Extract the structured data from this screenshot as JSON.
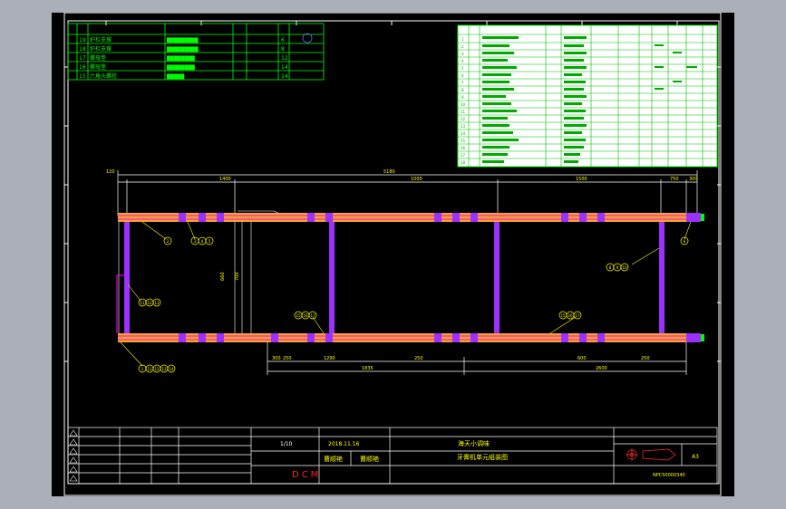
{
  "parts_table": {
    "rows": [
      {
        "no": "19",
        "name": "护栏支撑",
        "code": "█████████",
        "qty": "6"
      },
      {
        "no": "18",
        "name": "护栏支撑",
        "code": "█████████",
        "qty": "8"
      },
      {
        "no": "17",
        "name": "螺母垫",
        "code": "████████",
        "qty": "12"
      },
      {
        "no": "16",
        "name": "螺母垫",
        "code": "████████",
        "qty": "14"
      },
      {
        "no": "15",
        "name": "六角头螺栓",
        "code": "█████",
        "qty": "14"
      }
    ]
  },
  "dimensions": {
    "overall": "5180",
    "segments": [
      "1400",
      "1000",
      "1500",
      "750",
      "700"
    ],
    "end_left": "120",
    "end_right": "300",
    "bottom_left": "1835",
    "bottom_right": "2600",
    "bottom_segments": [
      "300",
      "250",
      "1290",
      "250",
      "600",
      "250",
      "750"
    ],
    "height_a": "660",
    "height_b": "700"
  },
  "balloons": {
    "left_top": "2",
    "group_top": [
      "3",
      "4",
      "5"
    ],
    "right_top": "6",
    "right_mid": [
      "8",
      "9",
      "10"
    ],
    "left_mid": [
      "11",
      "12",
      "13"
    ],
    "bottom_left": [
      "1",
      "11",
      "12",
      "13",
      "14"
    ],
    "bottom_mid": [
      "15",
      "16",
      "17"
    ],
    "bottom_right": [
      "15",
      "16",
      "17"
    ]
  },
  "title_block": {
    "scale": "1/10",
    "date": "2018.11.16",
    "company": "海天小调味",
    "drawing_title": "牙膏机单元组装图",
    "designer": "曹顺艳",
    "checker": "曹顺艳",
    "brand": "DCM",
    "sheet_size": "A3",
    "drawing_no": "NPC50000340"
  },
  "colors": {
    "background": "#000000",
    "frame": "#ffffff",
    "rail": "#f5a623",
    "rail_stripe": "#ff00ff",
    "dimension": "#ffff00",
    "table": "#00ff00",
    "post": "#9b30ff"
  }
}
